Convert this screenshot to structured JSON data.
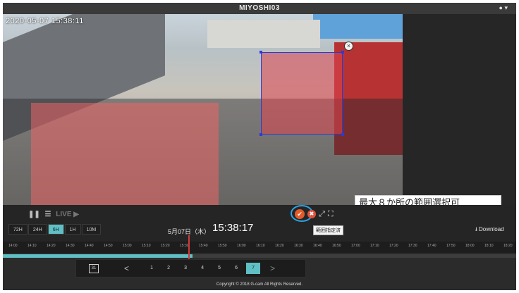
{
  "app": {
    "title": "MIYOSHI03",
    "user_menu": "▾"
  },
  "video": {
    "timestamp": "2020-05-07 15:38:11",
    "zone_close_icon": "×",
    "caption": "最大８か所の範囲選択可"
  },
  "controls": {
    "pause_icon": "❚❚",
    "menu_icon": "☰",
    "live_label": "LIVE ▶",
    "range_buttons": [
      "72H",
      "24H",
      "6H",
      "1H",
      "10M"
    ],
    "active_range": "6H",
    "date": "5月07日（木）",
    "clock": "15:38:17",
    "tools": {
      "confirm_icon": "✔",
      "cancel_icon": "✖",
      "shrink_icon": "⤢",
      "expand_icon": "⛶"
    },
    "tooltip": "範囲指定済",
    "download_label": "⭳ Download"
  },
  "timeline": {
    "ticks": [
      "14:00",
      "14:10",
      "14:20",
      "14:30",
      "14:40",
      "14:50",
      "15:00",
      "15:10",
      "15:20",
      "15:30",
      "15:40",
      "15:50",
      "16:00",
      "16:10",
      "16:20",
      "16:30",
      "16:40",
      "16:50",
      "17:00",
      "17:10",
      "17:20",
      "17:30",
      "17:40",
      "17:50",
      "18:00",
      "18:10",
      "18:20",
      "18:30"
    ],
    "progress_fraction": 0.37
  },
  "pager": {
    "calendar_icon": "31",
    "prev_icon": "<",
    "next_icon": ">",
    "pages": [
      "1",
      "2",
      "3",
      "4",
      "5",
      "6",
      "7"
    ],
    "active_page": "7"
  },
  "footer": {
    "copyright": "Copyright © 2018 G-cam All Rights Reserved."
  },
  "colors": {
    "accent": "#5fbfc4",
    "zone_fill": "#ec6464",
    "zone_border": "#2b3bd6",
    "cursor": "#d23a3a",
    "highlight_ring": "#29a6e8"
  }
}
